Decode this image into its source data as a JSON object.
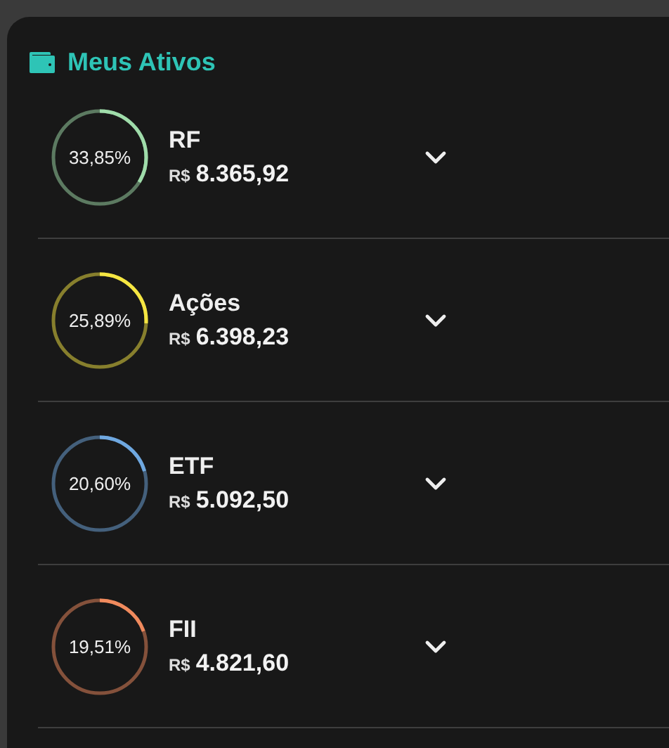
{
  "card": {
    "title": "Meus Ativos"
  },
  "assets": [
    {
      "percent": "33,85%",
      "level": 0.3385,
      "color": "#9fdcaa",
      "name": "RF",
      "currency": "R$",
      "amount": "8.365,92",
      "expanded": false
    },
    {
      "percent": "25,89%",
      "level": 0.2589,
      "color": "#f5e642",
      "name": "Ações",
      "currency": "R$",
      "amount": "6.398,23",
      "expanded": false
    },
    {
      "percent": "20,60%",
      "level": 0.206,
      "color": "#6fa8e0",
      "name": "ETF",
      "currency": "R$",
      "amount": "5.092,50",
      "expanded": false
    },
    {
      "percent": "19,51%",
      "level": 0.1951,
      "color": "#f08a5d",
      "name": "FII",
      "currency": "R$",
      "amount": "4.821,60",
      "expanded": false
    }
  ]
}
